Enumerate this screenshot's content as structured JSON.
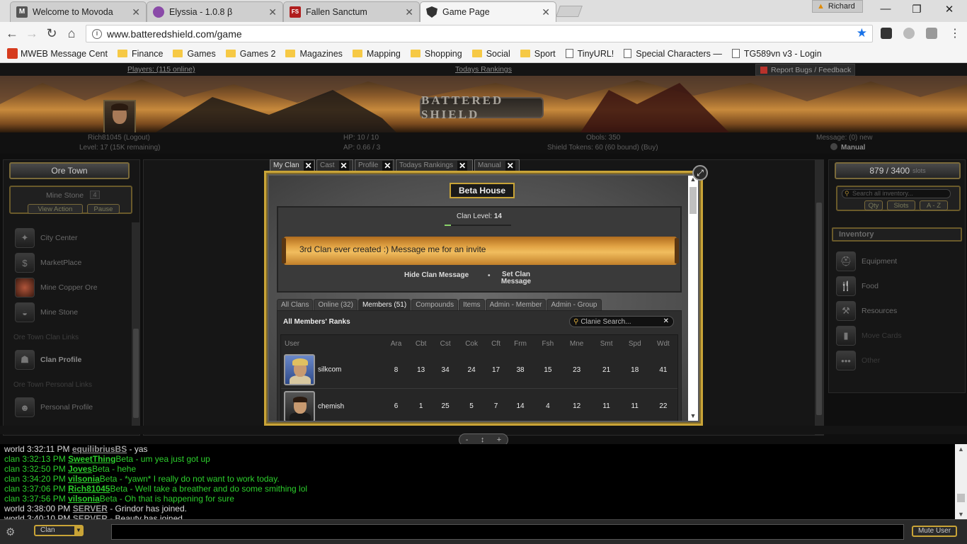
{
  "browser": {
    "tabs": [
      {
        "title": "Welcome to Movoda",
        "favicon_color": "#555555",
        "favicon_text": "M"
      },
      {
        "title": "Elyssia - 1.0.8 β",
        "favicon_color": "#8a4aa8",
        "favicon_text": ""
      },
      {
        "title": "Fallen Sanctum",
        "favicon_color": "#b01e1e",
        "favicon_text": "FS"
      },
      {
        "title": "Game Page",
        "favicon_color": "#333333",
        "favicon_text": ""
      }
    ],
    "profile_name": "Richard",
    "url": "www.batteredshield.com/game",
    "bookmarks": [
      {
        "label": "MWEB Message Cent",
        "type": "mweb"
      },
      {
        "label": "Finance",
        "type": "folder"
      },
      {
        "label": "Games",
        "type": "folder"
      },
      {
        "label": "Games 2",
        "type": "folder"
      },
      {
        "label": "Magazines",
        "type": "folder"
      },
      {
        "label": "Mapping",
        "type": "folder"
      },
      {
        "label": "Shopping",
        "type": "folder"
      },
      {
        "label": "Social",
        "type": "folder"
      },
      {
        "label": "Sport",
        "type": "folder"
      },
      {
        "label": "TinyURL!",
        "type": "page"
      },
      {
        "label": "Special Characters —",
        "type": "page"
      },
      {
        "label": "TG589vn v3 - Login",
        "type": "page"
      }
    ]
  },
  "game": {
    "players_online": "Players: (115 online)",
    "todays_rankings": "Todays Rankings",
    "report_bugs": "Report Bugs / Feedback",
    "logo_text": "BATTERED SHIELD",
    "player": {
      "name_line": "Rich81045 (Logout)",
      "level_line": "Level: 17 (15K remaining)",
      "hp": "HP: 10 / 10",
      "ap": "AP: 0.66 / 3",
      "obols": "Obols: 350",
      "shield_tokens": "Shield Tokens: 60 (60 bound) (Buy)",
      "message": "Message: (0) new",
      "manual": "Manual"
    },
    "left": {
      "town": "Ore Town",
      "node_name": "Mine Stone",
      "node_count": "4",
      "view_action": "View Action",
      "pause": "Pause",
      "nav_items": [
        {
          "label": "City Center",
          "icon": "compass-icon"
        },
        {
          "label": "MarketPlace",
          "icon": "money-bag-icon"
        },
        {
          "label": "Mine Copper Ore",
          "icon": "ore-icon"
        },
        {
          "label": "Mine Stone",
          "icon": "stone-icon"
        }
      ],
      "clan_links_title": "Ore Town Clan Links",
      "clan_profile": "Clan Profile",
      "personal_links_title": "Ore Town Personal Links",
      "personal_profile": "Personal Profile"
    },
    "right": {
      "slots_value": "879 / 3400",
      "slots_unit": "slots",
      "search_placeholder": "Search all inventory...",
      "sort_buttons": [
        "Qty",
        "Slots",
        "A - Z"
      ],
      "inventory_title": "Inventory",
      "categories": [
        {
          "label": "Equipment",
          "icon": "helmet-icon"
        },
        {
          "label": "Food",
          "icon": "cutlery-icon"
        },
        {
          "label": "Resources",
          "icon": "tools-icon"
        },
        {
          "label": "Move Cards",
          "icon": "cards-icon"
        },
        {
          "label": "Other",
          "icon": "dots-icon"
        }
      ]
    },
    "clan_window": {
      "tabs": [
        "My Clan",
        "Cast",
        "Profile",
        "Todays Rankings",
        "Manual"
      ],
      "clan_name": "Beta House",
      "clan_level_label": "Clan Level:",
      "clan_level": "14",
      "level_progress": 0.1,
      "clan_message": "3rd Clan ever created :) Message me for an invite",
      "hide_message": "Hide Clan Message",
      "set_message_line1": "Set Clan",
      "set_message_line2": "Message",
      "subtabs": [
        "All Clans",
        "Online (32)",
        "Members (51)",
        "Compounds",
        "Items",
        "Admin - Member",
        "Admin - Group"
      ],
      "active_subtab": 2,
      "ranks_title": "All Members' Ranks",
      "search_placeholder": "Clanie Search...",
      "columns": [
        "User",
        "Ara",
        "Cbt",
        "Cst",
        "Cok",
        "Cft",
        "Frm",
        "Fsh",
        "Mne",
        "Smt",
        "Spd",
        "Wdt"
      ],
      "rows": [
        {
          "name": "silkcom",
          "values": [
            "8",
            "13",
            "34",
            "24",
            "17",
            "38",
            "15",
            "23",
            "21",
            "18",
            "41"
          ]
        },
        {
          "name": "chemish",
          "values": [
            "6",
            "1",
            "25",
            "5",
            "7",
            "14",
            "4",
            "12",
            "11",
            "11",
            "22"
          ]
        }
      ]
    },
    "drawer": {
      "minus": "-",
      "plus": "+"
    },
    "chat": [
      {
        "channel": "world",
        "time": "3:32:11 PM",
        "name": "equilibriusBS",
        "suffix": "",
        "text": " - yas"
      },
      {
        "channel": "clan",
        "time": "3:32:13 PM",
        "name": "SweetThing",
        "suffix": "Beta",
        "text": " - um yea just got up"
      },
      {
        "channel": "clan",
        "time": "3:32:50 PM",
        "name": "Joves",
        "suffix": "Beta",
        "text": " - hehe"
      },
      {
        "channel": "clan",
        "time": "3:34:20 PM",
        "name": "vilsonia",
        "suffix": "Beta",
        "text": " - *yawn* I really do not want to work today."
      },
      {
        "channel": "clan",
        "time": "3:37:06 PM",
        "name": "Rich81045",
        "suffix": "Beta",
        "text": " - Well take a breather and do some smithing lol"
      },
      {
        "channel": "clan",
        "time": "3:37:56 PM",
        "name": "vilsonia",
        "suffix": "Beta",
        "text": " - Oh that is happening for sure"
      },
      {
        "channel": "world",
        "time": "3:38:00 PM",
        "name": "SERVER",
        "suffix": "",
        "text": " - Grindor has joined."
      },
      {
        "channel": "world",
        "time": "3:40:10 PM",
        "name": "SERVER",
        "suffix": "",
        "text": " - Beauty has joined."
      }
    ],
    "chat_channel": "Clan",
    "mute_user": "Mute User",
    "colors": {
      "gold": "#c9a437",
      "clan_chat": "#2ccf2c",
      "world_chat": "#dddddd"
    }
  }
}
